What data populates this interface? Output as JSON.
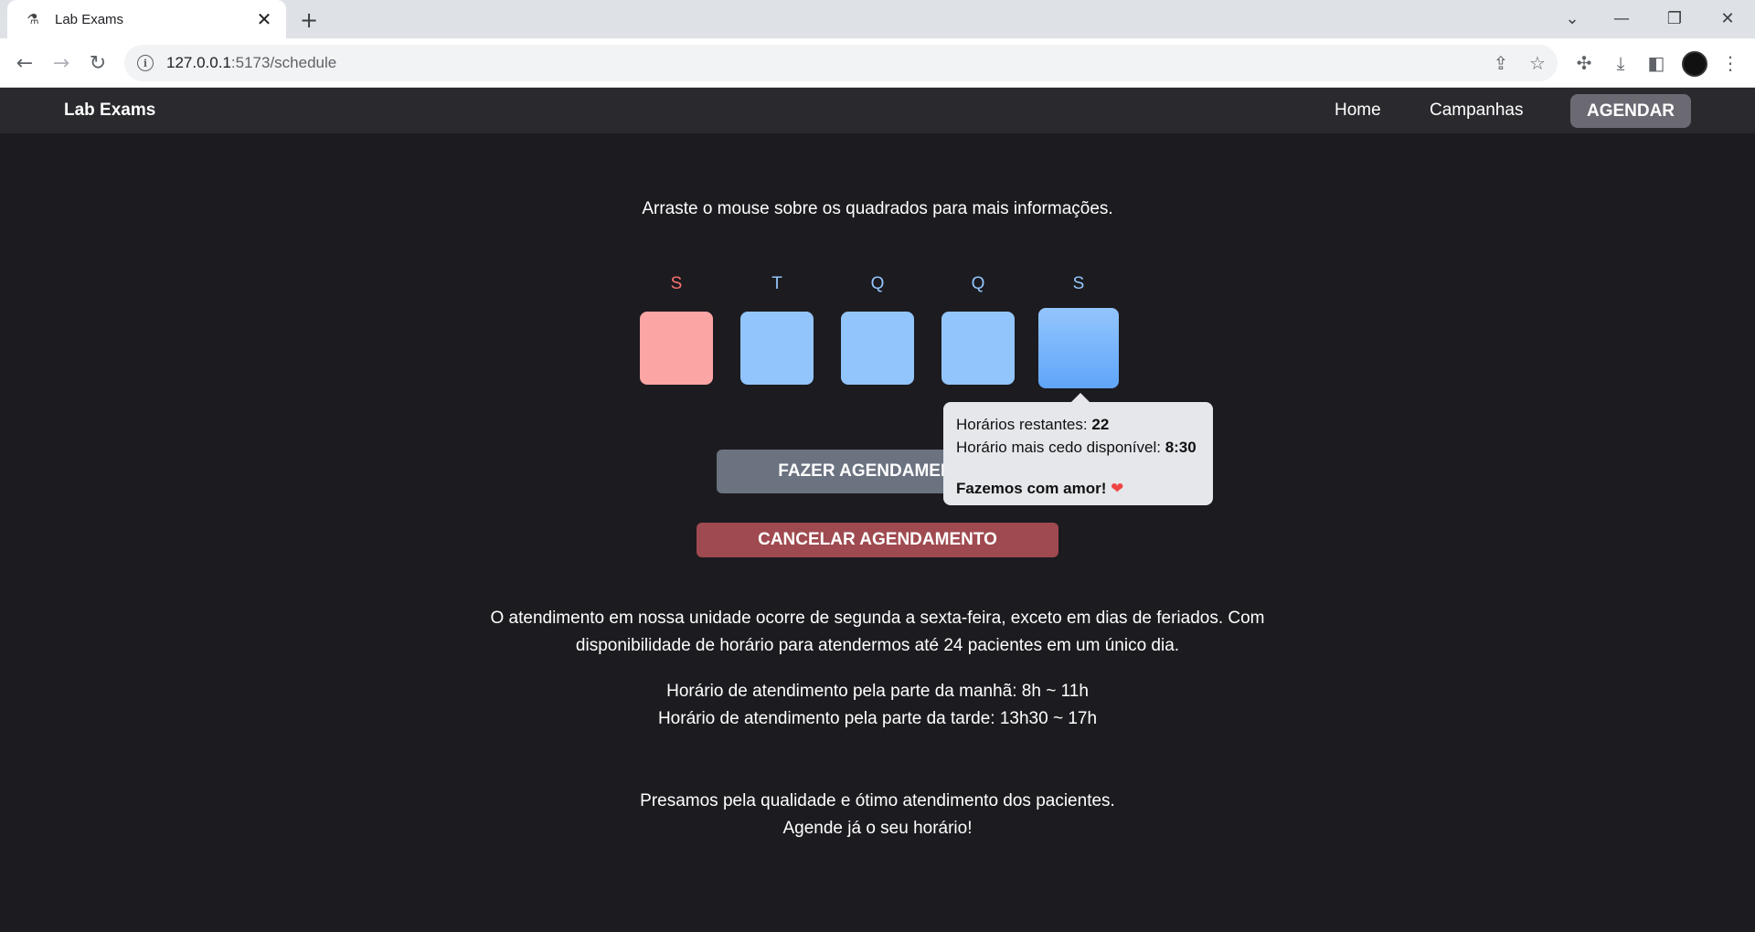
{
  "browser": {
    "tab_title": "Lab Exams",
    "tab_close": "✕",
    "new_tab": "+",
    "url_host": "127.0.0.1",
    "url_path": ":5173/schedule"
  },
  "navbar": {
    "brand": "Lab Exams",
    "links": [
      "Home",
      "Campanhas"
    ],
    "cta": "AGENDAR"
  },
  "schedule": {
    "hint": "Arraste o mouse sobre os quadrados para mais informações.",
    "days": [
      {
        "label": "S",
        "color": "#f87171"
      },
      {
        "label": "T",
        "color": "#93c5fd"
      },
      {
        "label": "Q",
        "color": "#93c5fd"
      },
      {
        "label": "Q",
        "color": "#93c5fd"
      },
      {
        "label": "S",
        "color": "#93c5fd"
      }
    ],
    "tooltip": {
      "remaining_label": "Horários restantes:",
      "remaining_value": "22",
      "earliest_label": "Horário mais cedo disponível:",
      "earliest_value": "8:30",
      "tagline": "Fazemos com amor!",
      "heart": "❤"
    },
    "schedule_button": "FAZER AGENDAMENTO",
    "cancel_button": "CANCELAR AGENDAMENTO"
  },
  "info": {
    "paragraph1_line1": "O atendimento em nossa unidade ocorre de segunda a sexta-feira, exceto em dias de feriados. Com",
    "paragraph1_line2": "disponibilidade de horário para atendermos até 24 pacientes em um único dia.",
    "morning": "Horário de atendimento pela parte da manhã: 8h ~ 11h",
    "afternoon": "Horário de atendimento pela parte da tarde: 13h30 ~ 17h",
    "closing_line1": "Presamos pela qualidade e ótimo atendimento dos pacientes.",
    "closing_line2": "Agende já o seu horário!"
  }
}
